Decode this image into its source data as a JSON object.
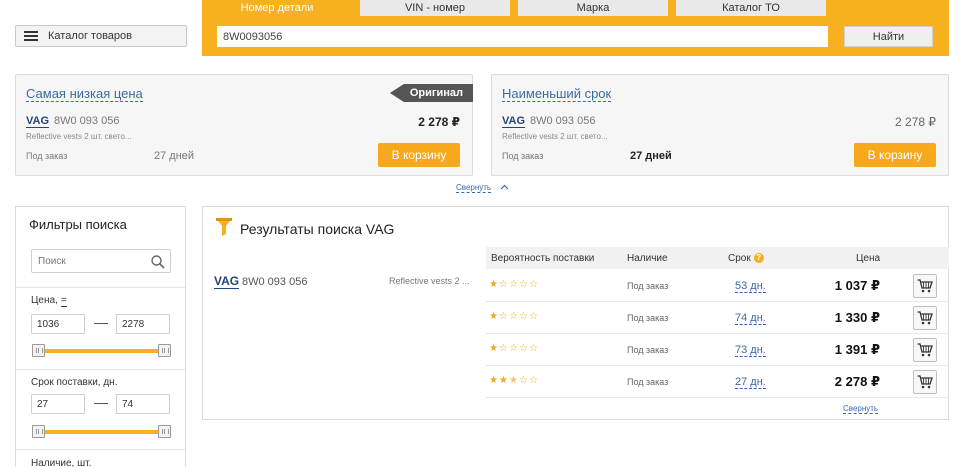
{
  "header": {
    "catalog_button": "Каталог товаров",
    "tabs": [
      {
        "label": "Номер детали",
        "active": true
      },
      {
        "label": "VIN - номер",
        "active": false
      },
      {
        "label": "Марка",
        "active": false
      },
      {
        "label": "Каталог ТО",
        "active": false
      }
    ],
    "search_value": "8W0093056",
    "find_button": "Найти"
  },
  "offers": [
    {
      "title": "Самая низкая цена",
      "badge": "Оригинал",
      "brand": "VAG",
      "part": "8W0 093 056",
      "desc": "Reflective vests 2 шт. свето...",
      "price": "2 278 ₽",
      "availability": "Под заказ",
      "term": "27 дней",
      "cart_button": "В корзину"
    },
    {
      "title": "Наименьший срок",
      "brand": "VAG",
      "part": "8W0 093 056",
      "desc": "Reflective vests 2 шт. свето...",
      "price": "2 278 ₽",
      "availability": "Под заказ",
      "term": "27 дней",
      "cart_button": "В корзину"
    }
  ],
  "collapse_label": "Свернуть",
  "filters": {
    "title": "Фильтры поиска",
    "search_placeholder": "Поиск",
    "price_label": "Цена,",
    "price_sort": "=",
    "price_from": "1036",
    "price_to": "2278",
    "term_label": "Срок поставки, дн.",
    "term_from": "27",
    "term_to": "74",
    "qty_label": "Наличие, шт."
  },
  "results": {
    "title": "Результаты поиска VAG",
    "columns": {
      "probability": "Вероятность поставки",
      "availability": "Наличие",
      "term": "Срок",
      "price": "Цена"
    },
    "brand": "VAG",
    "part": "8W0 093 056",
    "desc": "Reflective vests 2 ...",
    "rows": [
      {
        "stars": 1,
        "availability": "Под заказ",
        "days": "53 дн.",
        "price": "1 037 ₽"
      },
      {
        "stars": 1,
        "availability": "Под заказ",
        "days": "74 дн.",
        "price": "1 330 ₽"
      },
      {
        "stars": 1,
        "availability": "Под заказ",
        "days": "73 дн.",
        "price": "1 391 ₽"
      },
      {
        "stars": 2.5,
        "availability": "Под заказ",
        "days": "27 дн.",
        "price": "2 278 ₽"
      }
    ],
    "collapse": "Свернуть"
  },
  "colors": {
    "accent": "#f7b11e",
    "button": "#f7a81b",
    "link": "#3a6aa3",
    "brand": "#24447a"
  },
  "icons": {
    "menu": "hamburger-icon",
    "search": "search-icon",
    "funnel": "filter-icon",
    "cart": "cart-icon",
    "question": "question-icon",
    "chevron": "chevron-up-icon"
  }
}
